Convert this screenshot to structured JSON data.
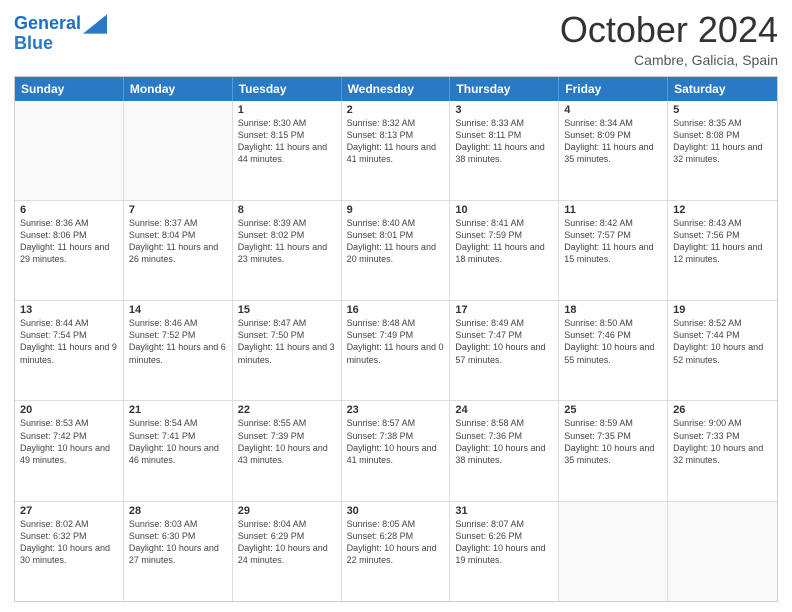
{
  "header": {
    "logo_line1": "General",
    "logo_line2": "Blue",
    "month": "October 2024",
    "location": "Cambre, Galicia, Spain"
  },
  "dayNames": [
    "Sunday",
    "Monday",
    "Tuesday",
    "Wednesday",
    "Thursday",
    "Friday",
    "Saturday"
  ],
  "rows": [
    [
      {
        "day": "",
        "sunrise": "",
        "sunset": "",
        "daylight": ""
      },
      {
        "day": "",
        "sunrise": "",
        "sunset": "",
        "daylight": ""
      },
      {
        "day": "1",
        "sunrise": "Sunrise: 8:30 AM",
        "sunset": "Sunset: 8:15 PM",
        "daylight": "Daylight: 11 hours and 44 minutes."
      },
      {
        "day": "2",
        "sunrise": "Sunrise: 8:32 AM",
        "sunset": "Sunset: 8:13 PM",
        "daylight": "Daylight: 11 hours and 41 minutes."
      },
      {
        "day": "3",
        "sunrise": "Sunrise: 8:33 AM",
        "sunset": "Sunset: 8:11 PM",
        "daylight": "Daylight: 11 hours and 38 minutes."
      },
      {
        "day": "4",
        "sunrise": "Sunrise: 8:34 AM",
        "sunset": "Sunset: 8:09 PM",
        "daylight": "Daylight: 11 hours and 35 minutes."
      },
      {
        "day": "5",
        "sunrise": "Sunrise: 8:35 AM",
        "sunset": "Sunset: 8:08 PM",
        "daylight": "Daylight: 11 hours and 32 minutes."
      }
    ],
    [
      {
        "day": "6",
        "sunrise": "Sunrise: 8:36 AM",
        "sunset": "Sunset: 8:06 PM",
        "daylight": "Daylight: 11 hours and 29 minutes."
      },
      {
        "day": "7",
        "sunrise": "Sunrise: 8:37 AM",
        "sunset": "Sunset: 8:04 PM",
        "daylight": "Daylight: 11 hours and 26 minutes."
      },
      {
        "day": "8",
        "sunrise": "Sunrise: 8:39 AM",
        "sunset": "Sunset: 8:02 PM",
        "daylight": "Daylight: 11 hours and 23 minutes."
      },
      {
        "day": "9",
        "sunrise": "Sunrise: 8:40 AM",
        "sunset": "Sunset: 8:01 PM",
        "daylight": "Daylight: 11 hours and 20 minutes."
      },
      {
        "day": "10",
        "sunrise": "Sunrise: 8:41 AM",
        "sunset": "Sunset: 7:59 PM",
        "daylight": "Daylight: 11 hours and 18 minutes."
      },
      {
        "day": "11",
        "sunrise": "Sunrise: 8:42 AM",
        "sunset": "Sunset: 7:57 PM",
        "daylight": "Daylight: 11 hours and 15 minutes."
      },
      {
        "day": "12",
        "sunrise": "Sunrise: 8:43 AM",
        "sunset": "Sunset: 7:56 PM",
        "daylight": "Daylight: 11 hours and 12 minutes."
      }
    ],
    [
      {
        "day": "13",
        "sunrise": "Sunrise: 8:44 AM",
        "sunset": "Sunset: 7:54 PM",
        "daylight": "Daylight: 11 hours and 9 minutes."
      },
      {
        "day": "14",
        "sunrise": "Sunrise: 8:46 AM",
        "sunset": "Sunset: 7:52 PM",
        "daylight": "Daylight: 11 hours and 6 minutes."
      },
      {
        "day": "15",
        "sunrise": "Sunrise: 8:47 AM",
        "sunset": "Sunset: 7:50 PM",
        "daylight": "Daylight: 11 hours and 3 minutes."
      },
      {
        "day": "16",
        "sunrise": "Sunrise: 8:48 AM",
        "sunset": "Sunset: 7:49 PM",
        "daylight": "Daylight: 11 hours and 0 minutes."
      },
      {
        "day": "17",
        "sunrise": "Sunrise: 8:49 AM",
        "sunset": "Sunset: 7:47 PM",
        "daylight": "Daylight: 10 hours and 57 minutes."
      },
      {
        "day": "18",
        "sunrise": "Sunrise: 8:50 AM",
        "sunset": "Sunset: 7:46 PM",
        "daylight": "Daylight: 10 hours and 55 minutes."
      },
      {
        "day": "19",
        "sunrise": "Sunrise: 8:52 AM",
        "sunset": "Sunset: 7:44 PM",
        "daylight": "Daylight: 10 hours and 52 minutes."
      }
    ],
    [
      {
        "day": "20",
        "sunrise": "Sunrise: 8:53 AM",
        "sunset": "Sunset: 7:42 PM",
        "daylight": "Daylight: 10 hours and 49 minutes."
      },
      {
        "day": "21",
        "sunrise": "Sunrise: 8:54 AM",
        "sunset": "Sunset: 7:41 PM",
        "daylight": "Daylight: 10 hours and 46 minutes."
      },
      {
        "day": "22",
        "sunrise": "Sunrise: 8:55 AM",
        "sunset": "Sunset: 7:39 PM",
        "daylight": "Daylight: 10 hours and 43 minutes."
      },
      {
        "day": "23",
        "sunrise": "Sunrise: 8:57 AM",
        "sunset": "Sunset: 7:38 PM",
        "daylight": "Daylight: 10 hours and 41 minutes."
      },
      {
        "day": "24",
        "sunrise": "Sunrise: 8:58 AM",
        "sunset": "Sunset: 7:36 PM",
        "daylight": "Daylight: 10 hours and 38 minutes."
      },
      {
        "day": "25",
        "sunrise": "Sunrise: 8:59 AM",
        "sunset": "Sunset: 7:35 PM",
        "daylight": "Daylight: 10 hours and 35 minutes."
      },
      {
        "day": "26",
        "sunrise": "Sunrise: 9:00 AM",
        "sunset": "Sunset: 7:33 PM",
        "daylight": "Daylight: 10 hours and 32 minutes."
      }
    ],
    [
      {
        "day": "27",
        "sunrise": "Sunrise: 8:02 AM",
        "sunset": "Sunset: 6:32 PM",
        "daylight": "Daylight: 10 hours and 30 minutes."
      },
      {
        "day": "28",
        "sunrise": "Sunrise: 8:03 AM",
        "sunset": "Sunset: 6:30 PM",
        "daylight": "Daylight: 10 hours and 27 minutes."
      },
      {
        "day": "29",
        "sunrise": "Sunrise: 8:04 AM",
        "sunset": "Sunset: 6:29 PM",
        "daylight": "Daylight: 10 hours and 24 minutes."
      },
      {
        "day": "30",
        "sunrise": "Sunrise: 8:05 AM",
        "sunset": "Sunset: 6:28 PM",
        "daylight": "Daylight: 10 hours and 22 minutes."
      },
      {
        "day": "31",
        "sunrise": "Sunrise: 8:07 AM",
        "sunset": "Sunset: 6:26 PM",
        "daylight": "Daylight: 10 hours and 19 minutes."
      },
      {
        "day": "",
        "sunrise": "",
        "sunset": "",
        "daylight": ""
      },
      {
        "day": "",
        "sunrise": "",
        "sunset": "",
        "daylight": ""
      }
    ]
  ]
}
